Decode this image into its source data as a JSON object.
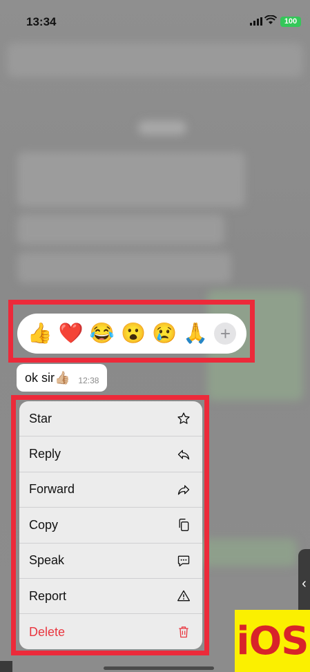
{
  "status_bar": {
    "time": "13:34",
    "battery": "100"
  },
  "reactions": [
    "👍",
    "❤️",
    "😂",
    "😮",
    "😢",
    "🙏"
  ],
  "more_reactions_label": "+",
  "message": {
    "text": "ok sir👍🏼",
    "time": "12:38"
  },
  "menu": {
    "items": [
      {
        "label": "Star",
        "icon": "star-icon"
      },
      {
        "label": "Reply",
        "icon": "reply-icon"
      },
      {
        "label": "Forward",
        "icon": "forward-icon"
      },
      {
        "label": "Copy",
        "icon": "copy-icon"
      },
      {
        "label": "Speak",
        "icon": "speak-icon"
      },
      {
        "label": "Report",
        "icon": "report-icon"
      },
      {
        "label": "Delete",
        "icon": "trash-icon"
      }
    ]
  },
  "badge": "iOS",
  "colors": {
    "highlight": "#ec2a3a",
    "delete": "#e9363f",
    "badge_bg": "#fbf000"
  }
}
